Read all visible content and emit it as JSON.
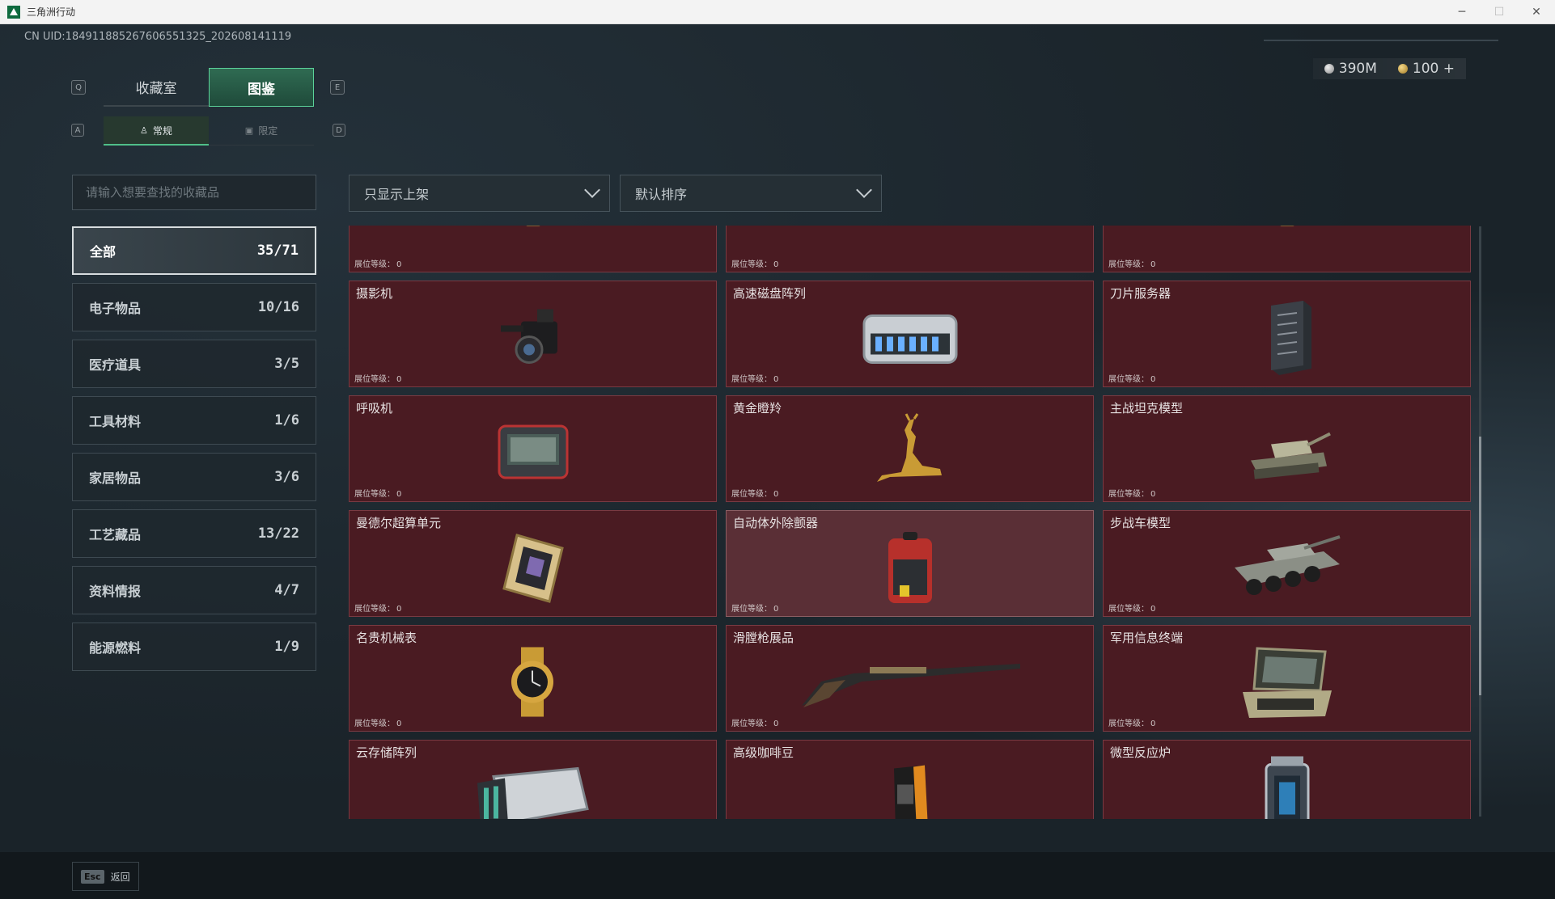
{
  "window": {
    "title": "三角洲行动",
    "min": "─",
    "max": "☐",
    "close": "✕"
  },
  "uid": "CN UID:184911885267606551325_202608141119",
  "currency": {
    "silver": "390M",
    "gold": "100",
    "add": "+"
  },
  "keys": {
    "q": "Q",
    "e": "E",
    "a": "A",
    "d": "D"
  },
  "tabs": [
    {
      "label": "收藏室"
    },
    {
      "label": "图鉴"
    }
  ],
  "subtabs": [
    {
      "label": "常规",
      "icon": "figure-icon"
    },
    {
      "label": "限定",
      "icon": "image-icon"
    }
  ],
  "search": {
    "placeholder": "请输入想要查找的收藏品"
  },
  "filters": {
    "display": "只显示上架",
    "sort": "默认排序"
  },
  "categories": [
    {
      "label": "全部",
      "count": "35/71"
    },
    {
      "label": "电子物品",
      "count": "10/16"
    },
    {
      "label": "医疗道具",
      "count": "3/5"
    },
    {
      "label": "工具材料",
      "count": "1/6"
    },
    {
      "label": "家居物品",
      "count": "3/6"
    },
    {
      "label": "工艺藏品",
      "count": "13/22"
    },
    {
      "label": "资料情报",
      "count": "4/7"
    },
    {
      "label": "能源燃料",
      "count": "1/9"
    }
  ],
  "level_label": "展位等级：",
  "items": [
    {
      "name": "",
      "level": "0",
      "icon": "gold-item-icon"
    },
    {
      "name": "",
      "level": "0",
      "icon": "rifle-icon"
    },
    {
      "name": "",
      "level": "0",
      "icon": "gold-item-icon"
    },
    {
      "name": "摄影机",
      "level": "0",
      "icon": "camera-icon"
    },
    {
      "name": "高速磁盘阵列",
      "level": "0",
      "icon": "disk-array-icon"
    },
    {
      "name": "刀片服务器",
      "level": "0",
      "icon": "server-icon"
    },
    {
      "name": "呼吸机",
      "level": "0",
      "icon": "ventilator-icon"
    },
    {
      "name": "黄金瞪羚",
      "level": "0",
      "icon": "gold-gazelle-icon"
    },
    {
      "name": "主战坦克模型",
      "level": "0",
      "icon": "tank-icon"
    },
    {
      "name": "曼德尔超算单元",
      "level": "0",
      "icon": "cpu-icon"
    },
    {
      "name": "自动体外除颤器",
      "level": "0",
      "icon": "defibrillator-icon"
    },
    {
      "name": "步战车模型",
      "level": "0",
      "icon": "apc-icon"
    },
    {
      "name": "名贵机械表",
      "level": "0",
      "icon": "watch-icon"
    },
    {
      "name": "滑膛枪展品",
      "level": "0",
      "icon": "musket-icon"
    },
    {
      "name": "军用信息终端",
      "level": "0",
      "icon": "terminal-icon"
    },
    {
      "name": "云存储阵列",
      "level": "0",
      "icon": "cloud-storage-icon"
    },
    {
      "name": "高级咖啡豆",
      "level": "0",
      "icon": "coffee-icon"
    },
    {
      "name": "微型反应炉",
      "level": "0",
      "icon": "reactor-icon"
    }
  ],
  "footer": {
    "key": "Esc",
    "label": "返回"
  }
}
